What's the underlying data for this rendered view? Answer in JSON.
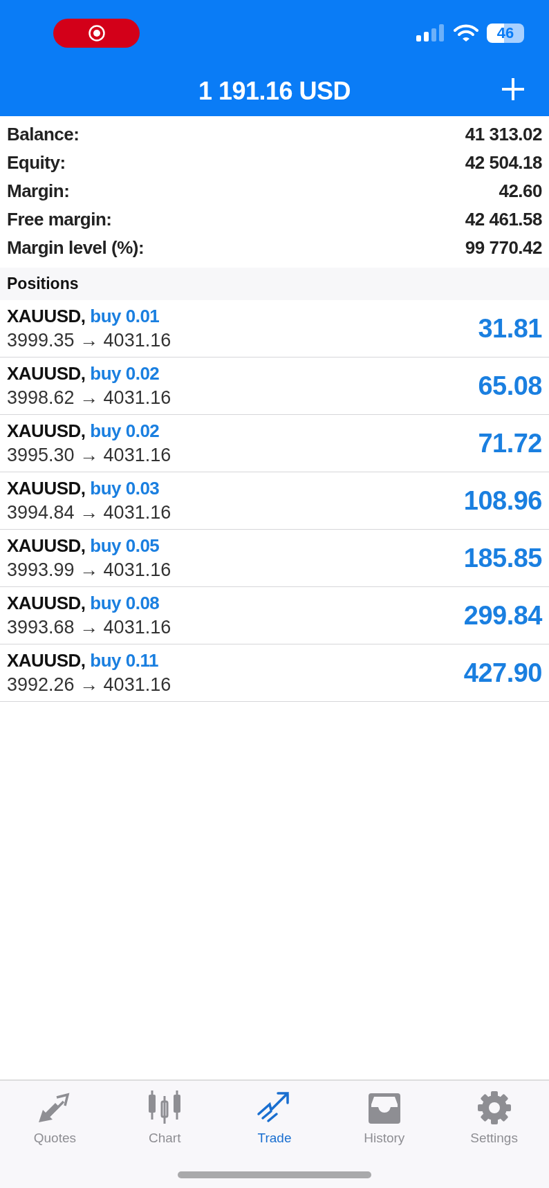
{
  "status_bar": {
    "battery": "46"
  },
  "header": {
    "title": "1 191.16 USD"
  },
  "summary": [
    {
      "label": "Balance:",
      "value": "41 313.02"
    },
    {
      "label": "Equity:",
      "value": "42 504.18"
    },
    {
      "label": "Margin:",
      "value": "42.60"
    },
    {
      "label": "Free margin:",
      "value": "42 461.58"
    },
    {
      "label": "Margin level (%):",
      "value": "99 770.42"
    }
  ],
  "positions_title": "Positions",
  "positions": [
    {
      "symbol": "XAUUSD,",
      "order": "buy 0.01",
      "prices": "3999.35 → 4031.16",
      "profit": "31.81"
    },
    {
      "symbol": "XAUUSD,",
      "order": "buy 0.02",
      "prices": "3998.62 → 4031.16",
      "profit": "65.08"
    },
    {
      "symbol": "XAUUSD,",
      "order": "buy 0.02",
      "prices": "3995.30 → 4031.16",
      "profit": "71.72"
    },
    {
      "symbol": "XAUUSD,",
      "order": "buy 0.03",
      "prices": "3994.84 → 4031.16",
      "profit": "108.96"
    },
    {
      "symbol": "XAUUSD,",
      "order": "buy 0.05",
      "prices": "3993.99 → 4031.16",
      "profit": "185.85"
    },
    {
      "symbol": "XAUUSD,",
      "order": "buy 0.08",
      "prices": "3993.68 → 4031.16",
      "profit": "299.84"
    },
    {
      "symbol": "XAUUSD,",
      "order": "buy 0.11",
      "prices": "3992.26 → 4031.16",
      "profit": "427.90"
    }
  ],
  "tabs": [
    {
      "kind": "quotes",
      "label": "Quotes",
      "selected": false
    },
    {
      "kind": "chart",
      "label": "Chart",
      "selected": false
    },
    {
      "kind": "trade",
      "label": "Trade",
      "selected": true
    },
    {
      "kind": "history",
      "label": "History",
      "selected": false
    },
    {
      "kind": "settings",
      "label": "Settings",
      "selected": false
    }
  ]
}
